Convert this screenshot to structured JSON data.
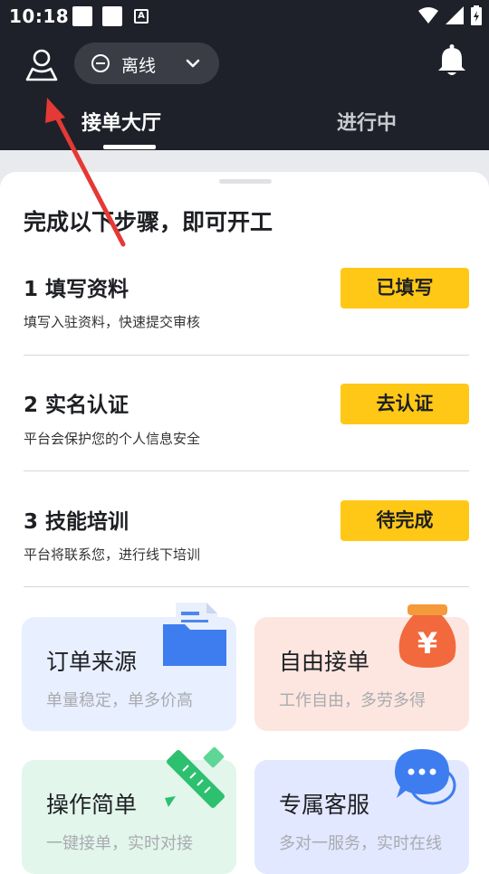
{
  "status_bar": {
    "time": "10:18",
    "a_glyph": "A",
    "icons": [
      "wifi-icon",
      "signal-icon",
      "battery-icon"
    ]
  },
  "header": {
    "online_status": "离线",
    "tabs": [
      {
        "label": "接单大厅",
        "active": true
      },
      {
        "label": "进行中",
        "active": false
      }
    ]
  },
  "onboarding": {
    "headline": "完成以下步骤，即可开工",
    "steps": [
      {
        "title": "1 填写资料",
        "desc": "填写入驻资料，快速提交审核",
        "button": "已填写"
      },
      {
        "title": "2 实名认证",
        "desc": "平台会保护您的个人信息安全",
        "button": "去认证"
      },
      {
        "title": "3 技能培训",
        "desc": "平台将联系您，进行线下培训",
        "button": "待完成"
      }
    ]
  },
  "features": [
    {
      "title": "订单来源",
      "subtitle": "单量稳定，单多价高",
      "icon": "folder-document-icon"
    },
    {
      "title": "自由接单",
      "subtitle": "工作自由，多劳多得",
      "icon": "money-bag-icon",
      "icon_glyph": "¥"
    },
    {
      "title": "操作简单",
      "subtitle": "一键接单，实时对接",
      "icon": "ruler-pencil-icon"
    },
    {
      "title": "专属客服",
      "subtitle": "多对一服务，实时在线",
      "icon": "chat-bubble-icon"
    }
  ],
  "colors": {
    "header_bg": "#1e2129",
    "accent_yellow": "#ffc816",
    "annotation_arrow": "#e53935"
  }
}
